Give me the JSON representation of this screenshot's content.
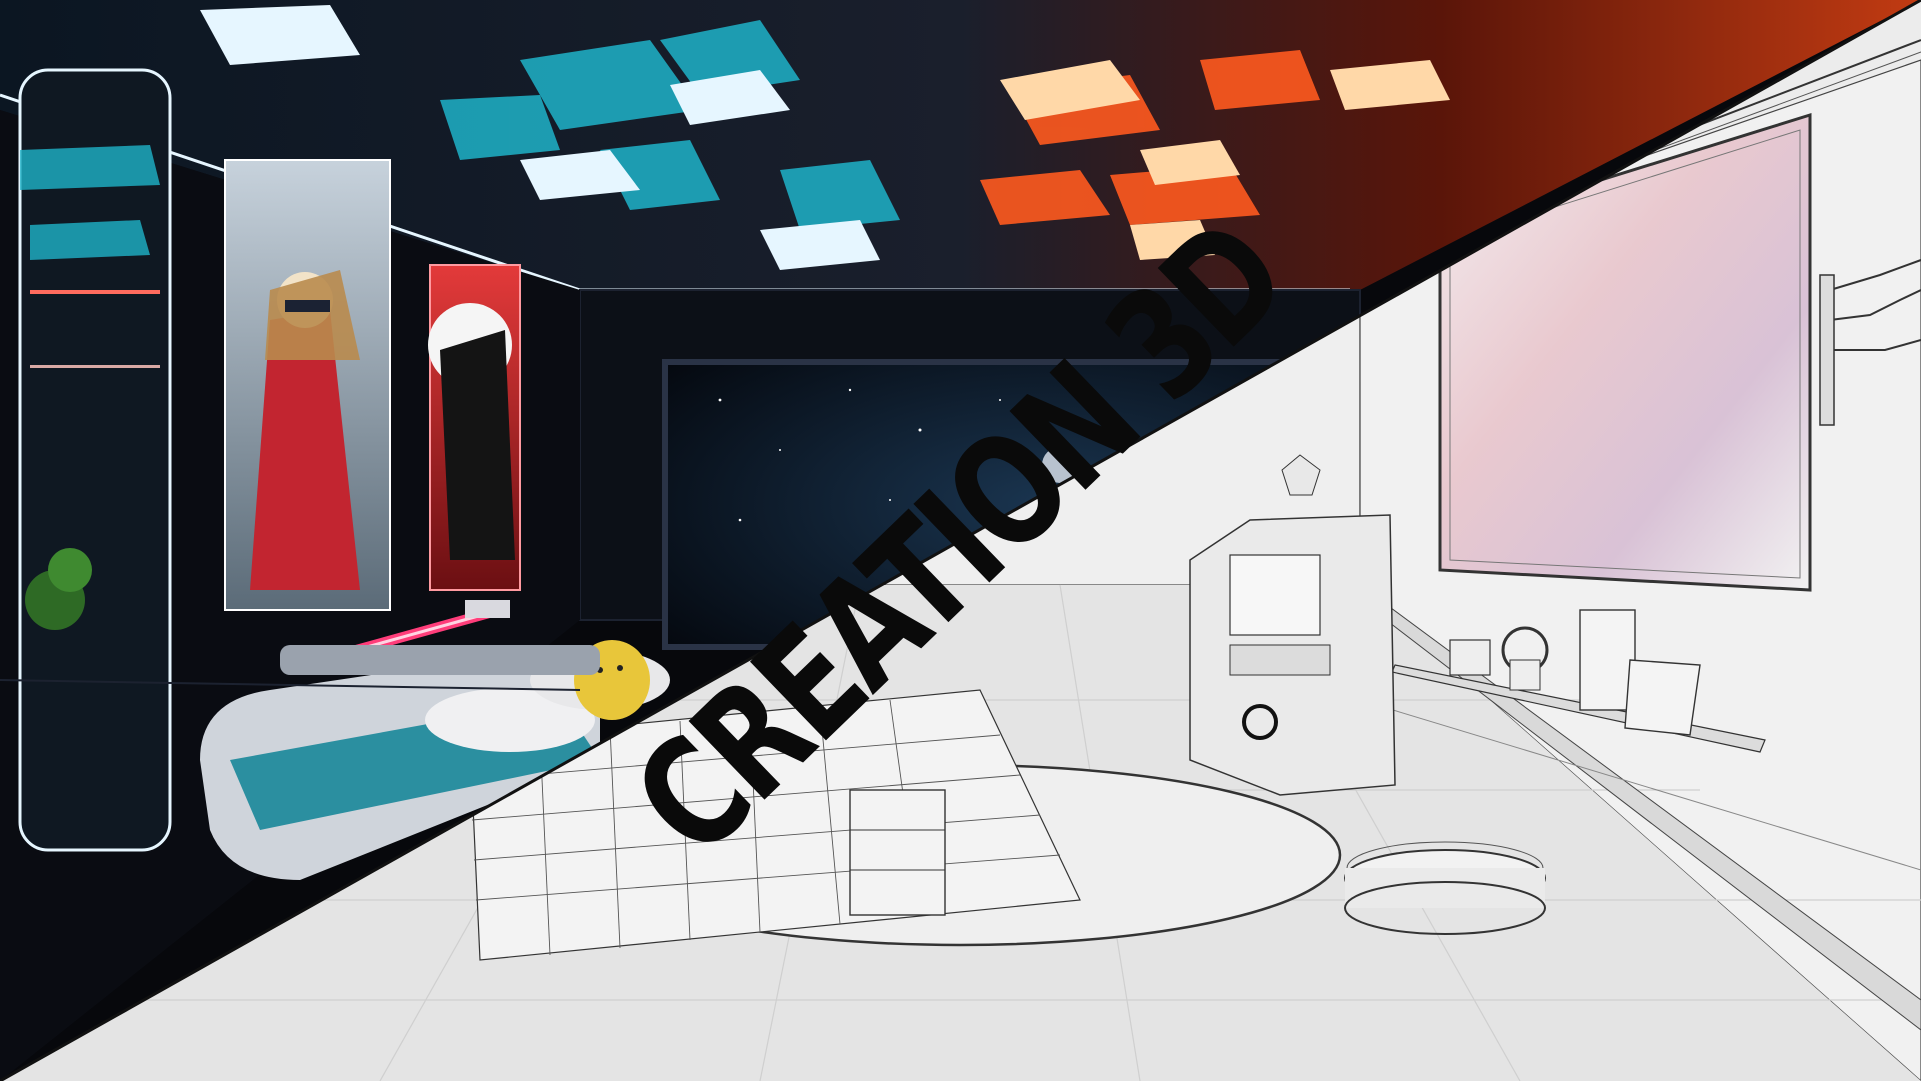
{
  "title": "CREATION 3D",
  "colors": {
    "ceiling_orange": "#ff5a1f",
    "ceiling_teal": "#1fb3c9",
    "panel_white": "#e6f6ff",
    "neon_pink": "#ff3d7a",
    "wire_bg": "#e9e9e9",
    "wire_line": "#3a3a3a",
    "room_dark": "#07080c",
    "space": "#0b1a2a"
  }
}
